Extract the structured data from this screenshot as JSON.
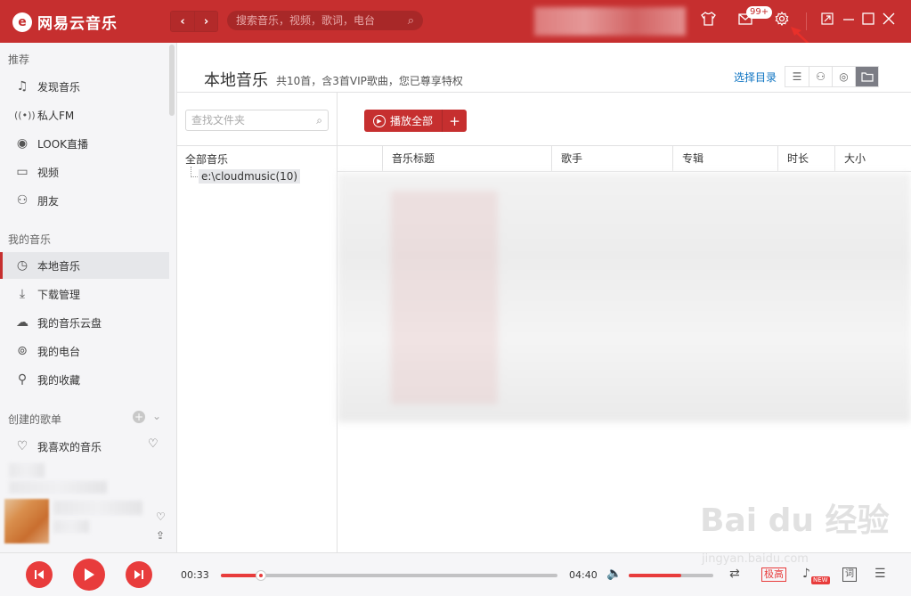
{
  "app": {
    "logo_glyph": "e",
    "name": "网易云音乐",
    "nav_back": "‹",
    "nav_forward": "›",
    "search_placeholder": "搜索音乐，视频，歌词，电台",
    "msg_badge": "99+"
  },
  "sidebar": {
    "sections": {
      "recommend": "推荐",
      "my_music": "我的音乐",
      "playlists": "创建的歌单"
    },
    "recommend_items": [
      {
        "label": "发现音乐",
        "icon": "music-note-icon"
      },
      {
        "label": "私人FM",
        "icon": "radio-icon"
      },
      {
        "label": "LOOK直播",
        "icon": "live-icon"
      },
      {
        "label": "视频",
        "icon": "video-icon"
      },
      {
        "label": "朋友",
        "icon": "friends-icon"
      }
    ],
    "my_music_items": [
      {
        "label": "本地音乐",
        "icon": "local-music-icon",
        "active": true
      },
      {
        "label": "下载管理",
        "icon": "download-icon"
      },
      {
        "label": "我的音乐云盘",
        "icon": "cloud-icon"
      },
      {
        "label": "我的电台",
        "icon": "podcast-icon"
      },
      {
        "label": "我的收藏",
        "icon": "collection-icon"
      }
    ],
    "playlist_items": [
      {
        "label": "我喜欢的音乐",
        "icon": "heart-icon"
      }
    ]
  },
  "main": {
    "title": "本地音乐",
    "subtitle": "共10首，含3首VIP歌曲，您已尊享特权",
    "select_dir": "选择目录",
    "folder_search_placeholder": "查找文件夹",
    "tree_root": "全部音乐",
    "tree_child": "e:\\cloudmusic(10)",
    "play_all": "播放全部",
    "add_symbol": "+",
    "columns": [
      "音乐标题",
      "歌手",
      "专辑",
      "时长",
      "大小"
    ]
  },
  "player": {
    "elapsed": "00:33",
    "duration": "04:40",
    "progress_fraction": 0.118,
    "volume_fraction": 0.62,
    "quality": "极高",
    "new_badge": "NEW",
    "lyric": "词"
  },
  "watermark": {
    "main": "Bai du 经验",
    "sub": "jingyan.baidu.com"
  }
}
